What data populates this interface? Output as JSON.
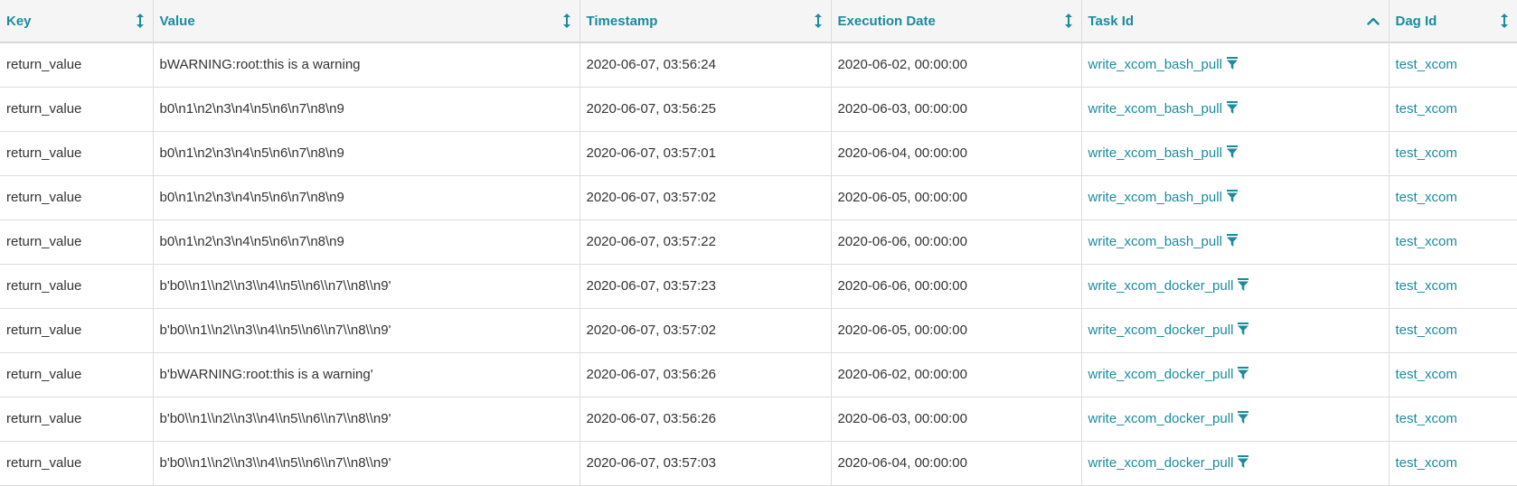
{
  "columns": [
    {
      "key": "key",
      "label": "Key",
      "sort": "both"
    },
    {
      "key": "value",
      "label": "Value",
      "sort": "both"
    },
    {
      "key": "timestamp",
      "label": "Timestamp",
      "sort": "both"
    },
    {
      "key": "execution_date",
      "label": "Execution Date",
      "sort": "both"
    },
    {
      "key": "task_id",
      "label": "Task Id",
      "sort": "asc"
    },
    {
      "key": "dag_id",
      "label": "Dag Id",
      "sort": "both"
    }
  ],
  "rows": [
    {
      "key": "return_value",
      "value": "bWARNING:root:this is a warning",
      "timestamp": "2020-06-07, 03:56:24",
      "execution_date": "2020-06-02, 00:00:00",
      "task_id": "write_xcom_bash_pull",
      "dag_id": "test_xcom"
    },
    {
      "key": "return_value",
      "value": "b0\\n1\\n2\\n3\\n4\\n5\\n6\\n7\\n8\\n9",
      "timestamp": "2020-06-07, 03:56:25",
      "execution_date": "2020-06-03, 00:00:00",
      "task_id": "write_xcom_bash_pull",
      "dag_id": "test_xcom"
    },
    {
      "key": "return_value",
      "value": "b0\\n1\\n2\\n3\\n4\\n5\\n6\\n7\\n8\\n9",
      "timestamp": "2020-06-07, 03:57:01",
      "execution_date": "2020-06-04, 00:00:00",
      "task_id": "write_xcom_bash_pull",
      "dag_id": "test_xcom"
    },
    {
      "key": "return_value",
      "value": "b0\\n1\\n2\\n3\\n4\\n5\\n6\\n7\\n8\\n9",
      "timestamp": "2020-06-07, 03:57:02",
      "execution_date": "2020-06-05, 00:00:00",
      "task_id": "write_xcom_bash_pull",
      "dag_id": "test_xcom"
    },
    {
      "key": "return_value",
      "value": "b0\\n1\\n2\\n3\\n4\\n5\\n6\\n7\\n8\\n9",
      "timestamp": "2020-06-07, 03:57:22",
      "execution_date": "2020-06-06, 00:00:00",
      "task_id": "write_xcom_bash_pull",
      "dag_id": "test_xcom"
    },
    {
      "key": "return_value",
      "value": "b'b0\\\\n1\\\\n2\\\\n3\\\\n4\\\\n5\\\\n6\\\\n7\\\\n8\\\\n9'",
      "timestamp": "2020-06-07, 03:57:23",
      "execution_date": "2020-06-06, 00:00:00",
      "task_id": "write_xcom_docker_pull",
      "dag_id": "test_xcom"
    },
    {
      "key": "return_value",
      "value": "b'b0\\\\n1\\\\n2\\\\n3\\\\n4\\\\n5\\\\n6\\\\n7\\\\n8\\\\n9'",
      "timestamp": "2020-06-07, 03:57:02",
      "execution_date": "2020-06-05, 00:00:00",
      "task_id": "write_xcom_docker_pull",
      "dag_id": "test_xcom"
    },
    {
      "key": "return_value",
      "value": "b'bWARNING:root:this is a warning'",
      "timestamp": "2020-06-07, 03:56:26",
      "execution_date": "2020-06-02, 00:00:00",
      "task_id": "write_xcom_docker_pull",
      "dag_id": "test_xcom"
    },
    {
      "key": "return_value",
      "value": "b'b0\\\\n1\\\\n2\\\\n3\\\\n4\\\\n5\\\\n6\\\\n7\\\\n8\\\\n9'",
      "timestamp": "2020-06-07, 03:56:26",
      "execution_date": "2020-06-03, 00:00:00",
      "task_id": "write_xcom_docker_pull",
      "dag_id": "test_xcom"
    },
    {
      "key": "return_value",
      "value": "b'b0\\\\n1\\\\n2\\\\n3\\\\n4\\\\n5\\\\n6\\\\n7\\\\n8\\\\n9'",
      "timestamp": "2020-06-07, 03:57:03",
      "execution_date": "2020-06-04, 00:00:00",
      "task_id": "write_xcom_docker_pull",
      "dag_id": "test_xcom"
    }
  ],
  "icons": {
    "sort_both": "sort-both-icon",
    "sort_asc": "sort-asc-icon",
    "filter": "filter-icon"
  },
  "colors": {
    "accent": "#1a8c9c",
    "text": "#333333",
    "header_bg": "#f5f5f5",
    "border": "#dddddd"
  }
}
